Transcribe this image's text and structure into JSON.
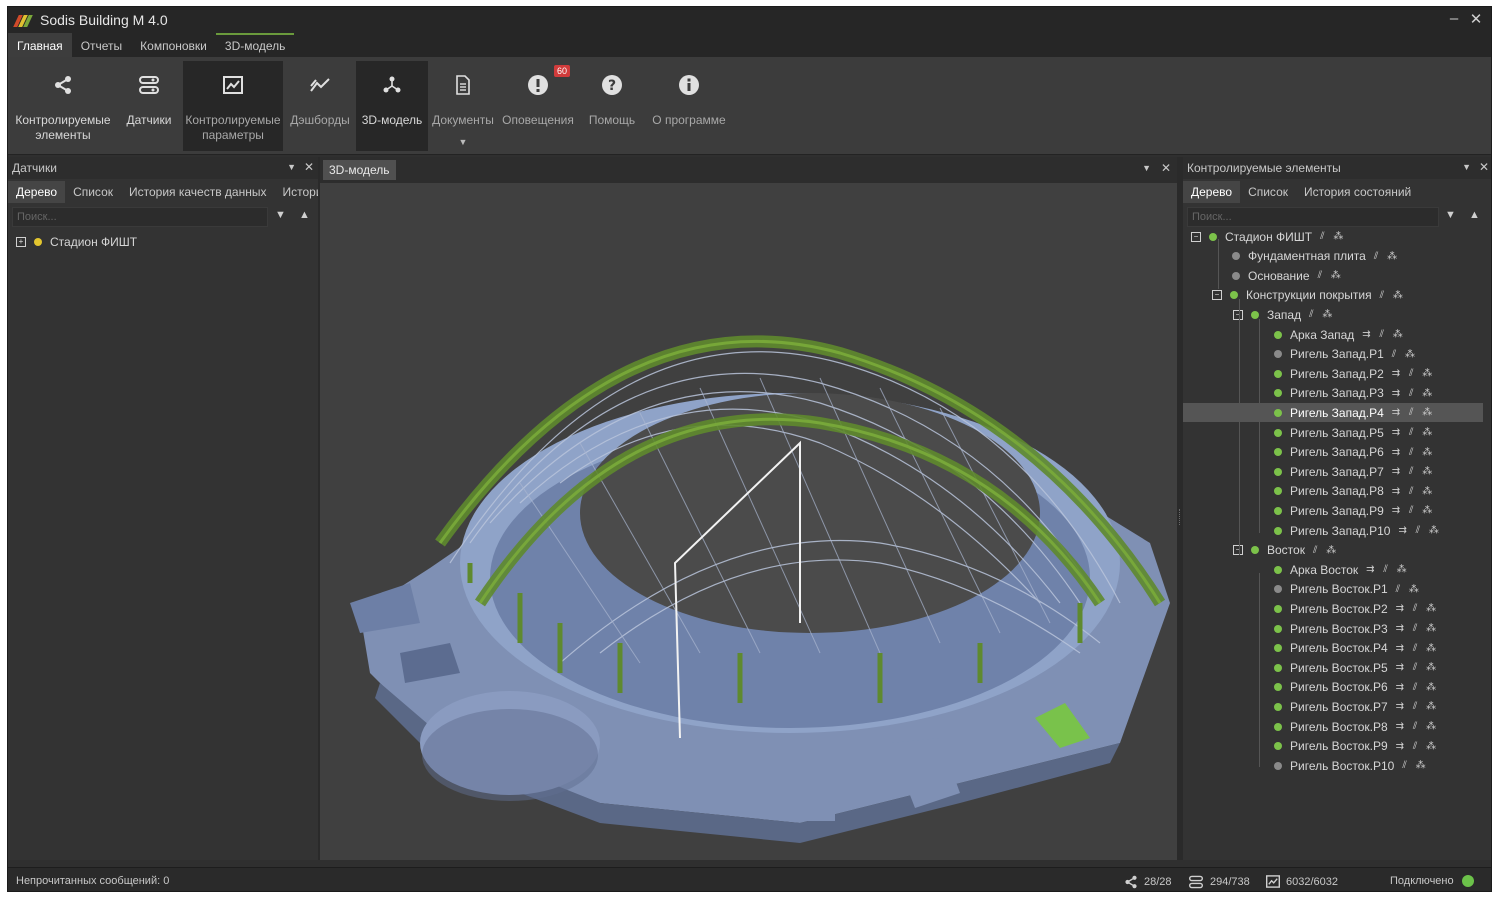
{
  "window": {
    "title": "Sodis Building M 4.0"
  },
  "ribbon_tabs": [
    {
      "label": "Главная"
    },
    {
      "label": "Отчеты"
    },
    {
      "label": "Компоновки"
    },
    {
      "label": "3D-модель"
    }
  ],
  "ribbon": {
    "buttons": [
      {
        "label": "Контролируемые элементы",
        "icon": "share-icon"
      },
      {
        "label": "Датчики",
        "icon": "sensors-icon"
      },
      {
        "label": "Контролируемые параметры",
        "icon": "chart-box-icon"
      },
      {
        "label": "Дэшборды",
        "icon": "trend-icon"
      },
      {
        "label": "3D-модель",
        "icon": "model-nodes-icon"
      },
      {
        "label": "Документы",
        "icon": "document-icon"
      },
      {
        "label": "Оповещения",
        "icon": "alert-icon",
        "badge": "60"
      },
      {
        "label": "Помощь",
        "icon": "help-icon"
      },
      {
        "label": "О программе",
        "icon": "info-icon"
      }
    ]
  },
  "left_panel": {
    "title": "Датчики",
    "tabs": [
      "Дерево",
      "Список",
      "История качеств данных",
      "Истори"
    ],
    "search_placeholder": "Поиск...",
    "tree": [
      {
        "label": "Стадион ФИШТ",
        "status_color": "#e3c62f"
      }
    ]
  },
  "center_panel": {
    "tab": "3D-модель"
  },
  "right_panel": {
    "title": "Контролируемые элементы",
    "tabs": [
      "Дерево",
      "Список",
      "История состояний"
    ],
    "search_placeholder": "Поиск...",
    "tree": [
      {
        "label": "Стадион ФИШТ",
        "level": 0,
        "expander": "⊟",
        "color": "#7cc24a"
      },
      {
        "label": "Фундаментная плита",
        "level": 1,
        "color": "#8a8a8a"
      },
      {
        "label": "Основание",
        "level": 1,
        "color": "#8a8a8a"
      },
      {
        "label": "Конструкции покрытия",
        "level": 1,
        "expander": "⊟",
        "color": "#7cc24a"
      },
      {
        "label": "Запад",
        "level": 2,
        "expander": "⊟",
        "color": "#7cc24a"
      },
      {
        "label": "Арка Запад",
        "level": 3,
        "color": "#7cc24a"
      },
      {
        "label": "Ригель Запад.Р1",
        "level": 3,
        "color": "#8a8a8a"
      },
      {
        "label": "Ригель Запад.Р2",
        "level": 3,
        "color": "#7cc24a"
      },
      {
        "label": "Ригель Запад.Р3",
        "level": 3,
        "color": "#7cc24a"
      },
      {
        "label": "Ригель Запад.Р4",
        "level": 3,
        "color": "#7cc24a",
        "selected": true
      },
      {
        "label": "Ригель Запад.Р5",
        "level": 3,
        "color": "#7cc24a"
      },
      {
        "label": "Ригель Запад.Р6",
        "level": 3,
        "color": "#7cc24a"
      },
      {
        "label": "Ригель Запад.Р7",
        "level": 3,
        "color": "#7cc24a"
      },
      {
        "label": "Ригель Запад.Р8",
        "level": 3,
        "color": "#7cc24a"
      },
      {
        "label": "Ригель Запад.Р9",
        "level": 3,
        "color": "#7cc24a"
      },
      {
        "label": "Ригель Запад.Р10",
        "level": 3,
        "color": "#7cc24a"
      },
      {
        "label": "Восток",
        "level": 2,
        "expander": "⊟",
        "color": "#7cc24a"
      },
      {
        "label": "Арка Восток",
        "level": 3,
        "color": "#7cc24a"
      },
      {
        "label": "Ригель Восток.Р1",
        "level": 3,
        "color": "#8a8a8a"
      },
      {
        "label": "Ригель Восток.Р2",
        "level": 3,
        "color": "#7cc24a"
      },
      {
        "label": "Ригель Восток.Р3",
        "level": 3,
        "color": "#7cc24a"
      },
      {
        "label": "Ригель Восток.Р4",
        "level": 3,
        "color": "#7cc24a"
      },
      {
        "label": "Ригель Восток.Р5",
        "level": 3,
        "color": "#7cc24a"
      },
      {
        "label": "Ригель Восток.Р6",
        "level": 3,
        "color": "#7cc24a"
      },
      {
        "label": "Ригель Восток.Р7",
        "level": 3,
        "color": "#7cc24a"
      },
      {
        "label": "Ригель Восток.Р8",
        "level": 3,
        "color": "#7cc24a"
      },
      {
        "label": "Ригель Восток.Р9",
        "level": 3,
        "color": "#7cc24a"
      },
      {
        "label": "Ригель Восток.Р10",
        "level": 3,
        "color": "#8a8a8a"
      }
    ]
  },
  "status_bar": {
    "message": "Непрочитанных сообщений: 0",
    "elements_count": "28/28",
    "sensors_count": "294/738",
    "params_count": "6032/6032",
    "connection": "Подключено",
    "connection_color": "#6cc24a"
  },
  "colors": {
    "accent_green": "#6a9a3c",
    "alert_red": "#d13b3b",
    "logo": [
      "#e0c030",
      "#d04a2a",
      "#7aa83a"
    ]
  }
}
